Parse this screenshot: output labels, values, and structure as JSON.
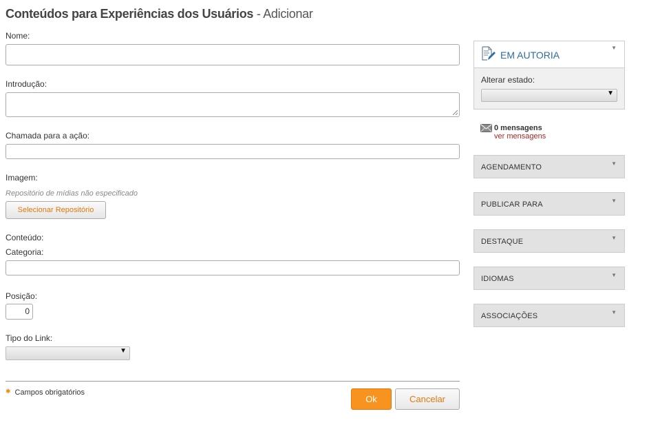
{
  "header": {
    "title": "Conteúdos para Experiências dos Usuários",
    "subtitle": "- Adicionar"
  },
  "form": {
    "nome_label": "Nome:",
    "introducao_label": "Introdução:",
    "chamada_label": "Chamada para a ação:",
    "imagem_label": "Imagem:",
    "repo_hint": "Repositório de mídias não especificado",
    "select_repo_button": "Selecionar Repositório",
    "conteudo_label": "Conteúdo:",
    "categoria_label": "Categoria:",
    "posicao_label": "Posição:",
    "posicao_value": "0",
    "tipo_link_label": "Tipo do Link:",
    "required_note": "Campos obrigatórios",
    "ok_button": "Ok",
    "cancel_button": "Cancelar"
  },
  "sidebar": {
    "status": "EM AUTORIA",
    "alterar_estado_label": "Alterar estado:",
    "messages_count": "0 mensagens",
    "messages_link": "ver mensagens",
    "panels": [
      "AGENDAMENTO",
      "PUBLICAR PARA",
      "DESTAQUE",
      "IDIOMAS",
      "ASSOCIAÇÕES"
    ]
  },
  "colors": {
    "accent": "#f7931e",
    "status_blue": "#2a6ea6",
    "link_red": "#b22222"
  },
  "icons": {
    "status": "document-edit-icon",
    "messages": "envelope-icon",
    "panel_toggle": "triangle-down-icon",
    "select": "chevron-down-icon"
  }
}
